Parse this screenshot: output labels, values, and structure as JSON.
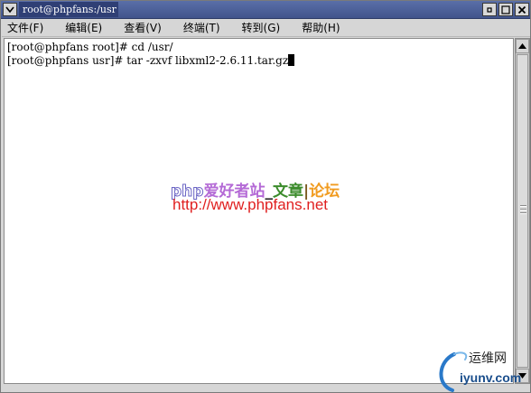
{
  "window": {
    "title": "root@phpfans:/usr"
  },
  "menubar": {
    "items": [
      {
        "label": "文件(F)"
      },
      {
        "label": "编辑(E)"
      },
      {
        "label": "查看(V)"
      },
      {
        "label": "终端(T)"
      },
      {
        "label": "转到(G)"
      },
      {
        "label": "帮助(H)"
      }
    ]
  },
  "terminal": {
    "lines": [
      "[root@phpfans root]# cd /usr/",
      "[root@phpfans usr]# tar -zxvf libxml2-2.6.11.tar.gz"
    ]
  },
  "watermark": {
    "php": "php",
    "lovers": "爱好者站",
    "sep": "_",
    "article": "文章",
    "bar": "|",
    "forum": "论坛",
    "url": "http://www.phpfans.net"
  },
  "logo": {
    "top_text": "运维网",
    "bottom_text": "iyunv.com"
  },
  "colors": {
    "titlebar": "#41548c",
    "terminal_bg": "#ffffff",
    "url": "#e02020",
    "forum": "#f19b1f",
    "article": "#3c8c2c"
  }
}
